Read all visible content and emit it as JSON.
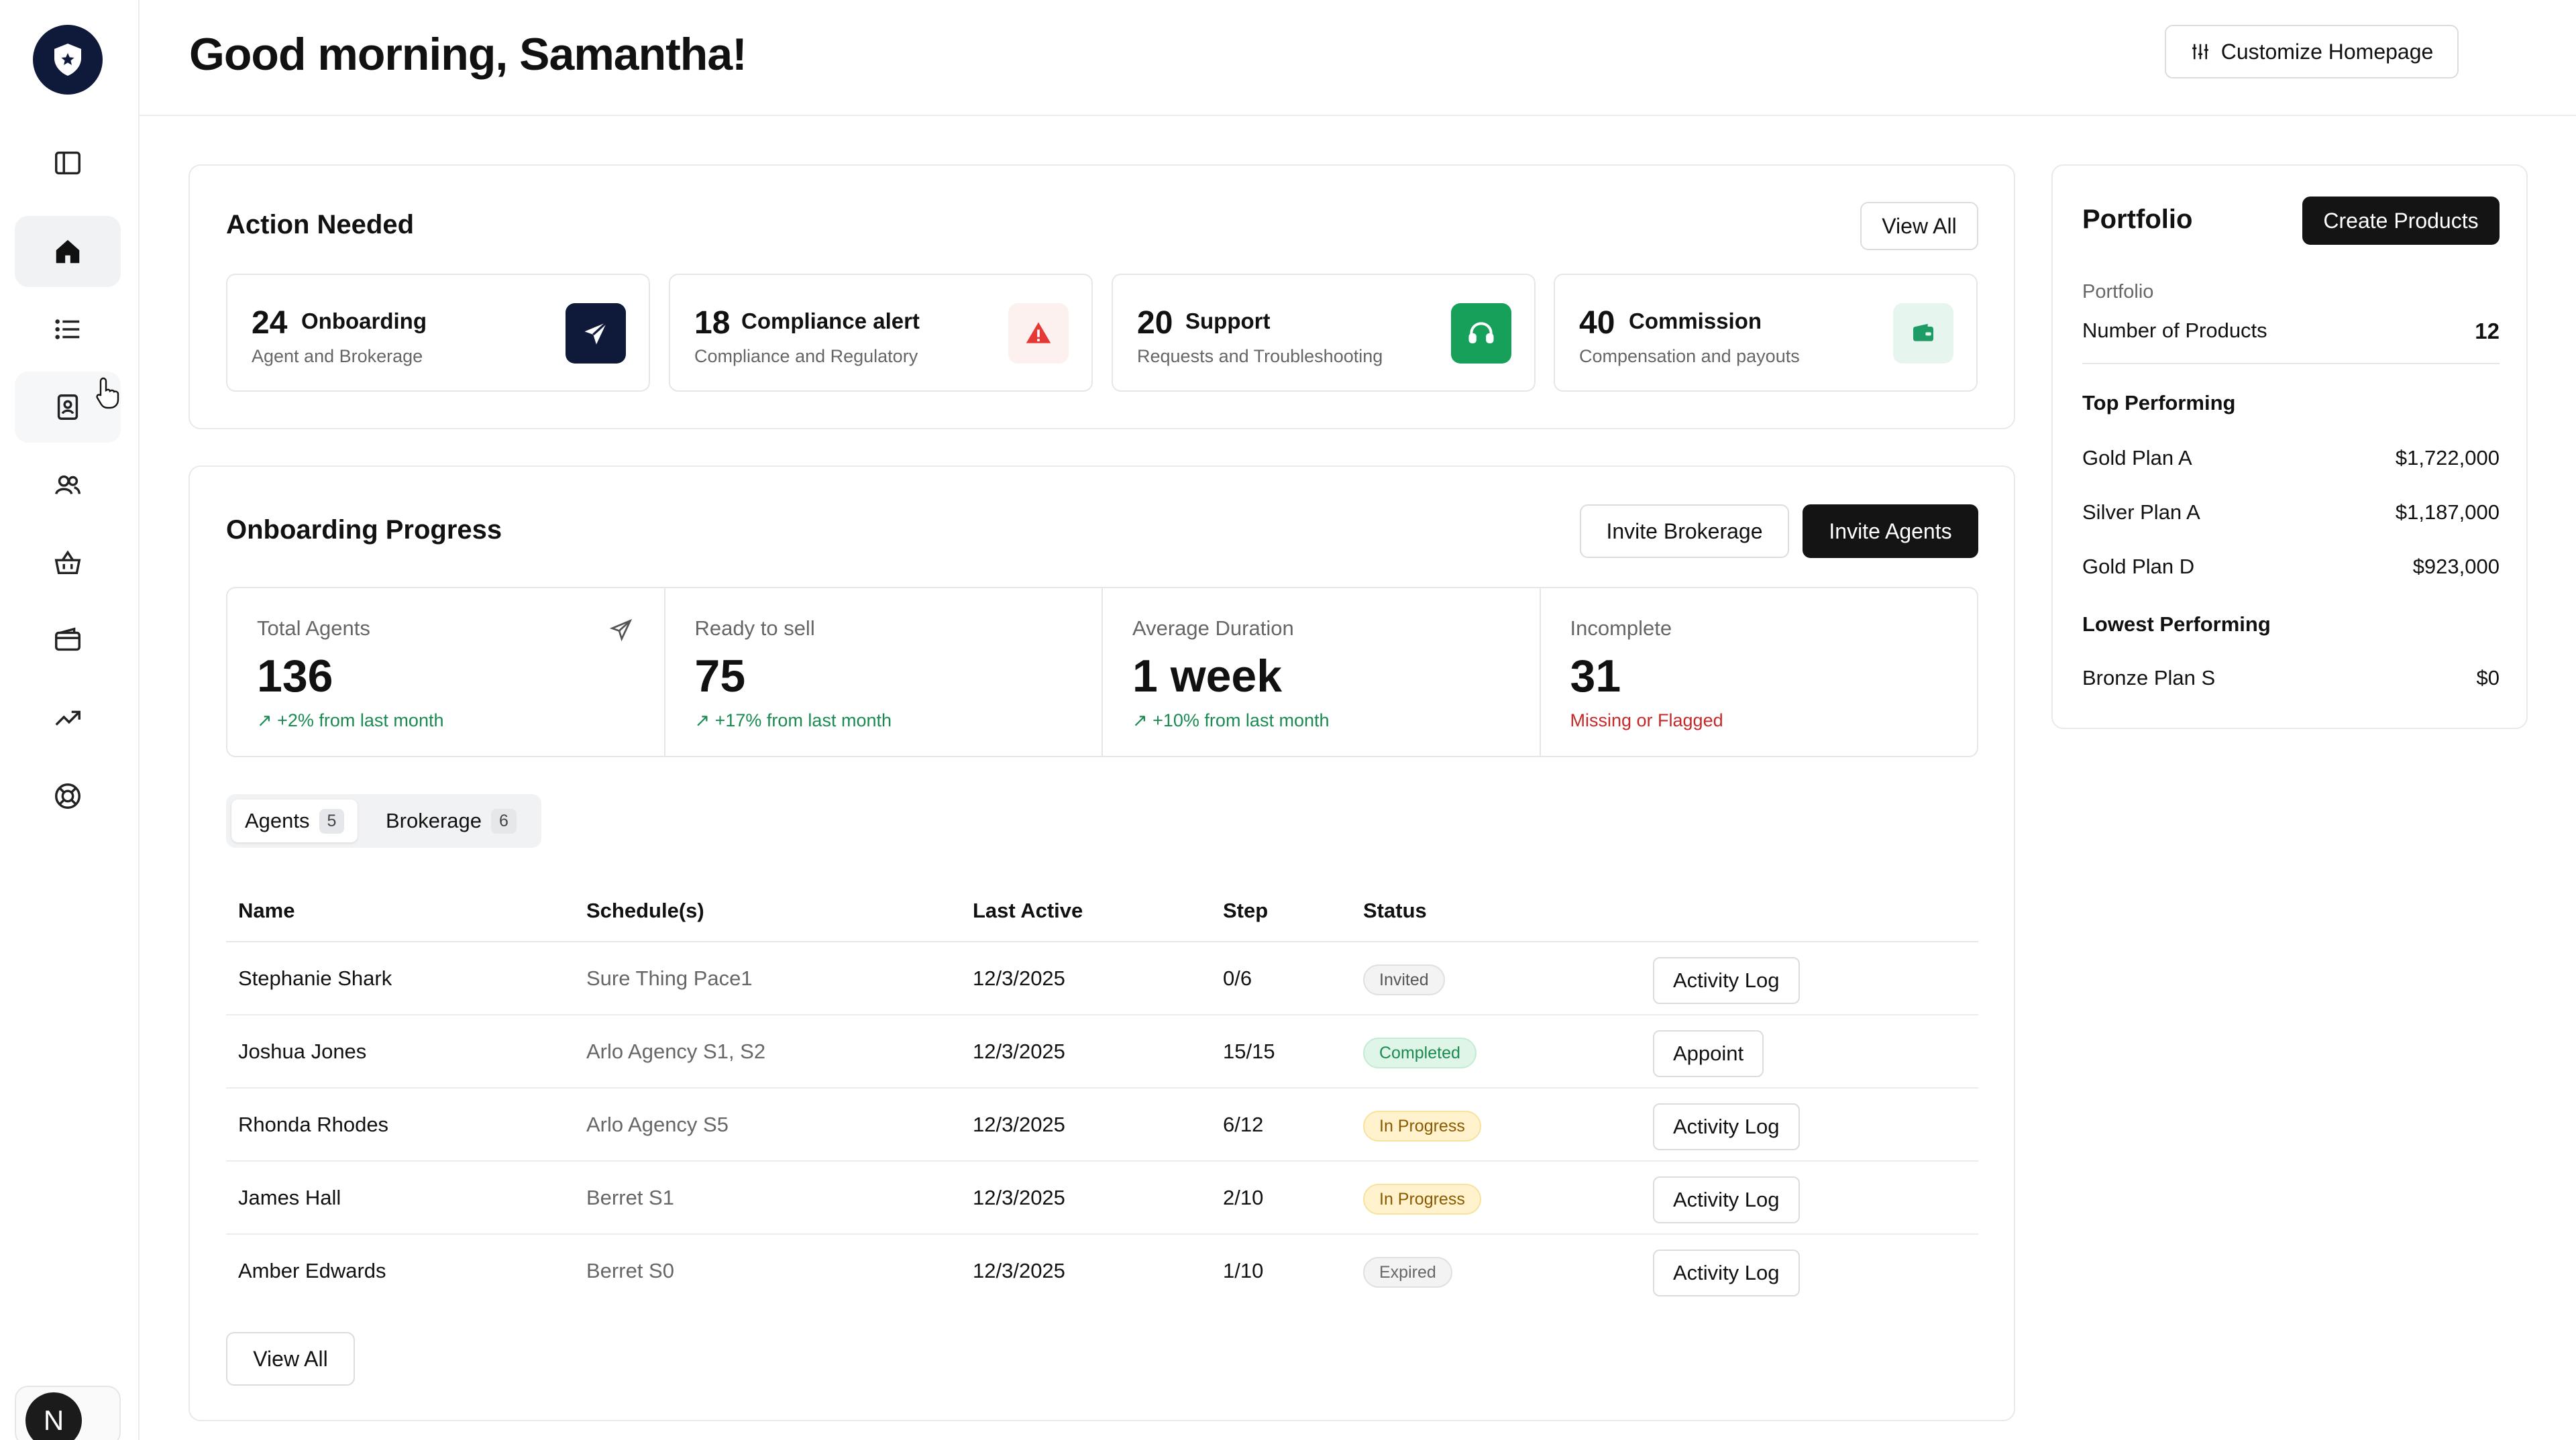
{
  "header": {
    "greeting": "Good morning, Samantha!",
    "customize_label": "Customize Homepage"
  },
  "sidebar": {
    "items": [
      "sidebar-toggle",
      "home",
      "list",
      "contacts",
      "users",
      "products",
      "wallet",
      "trends",
      "support"
    ],
    "avatar_letter": "N"
  },
  "action_needed": {
    "title": "Action Needed",
    "view_all": "View All",
    "tiles": [
      {
        "count": "24",
        "label": "Onboarding",
        "sub": "Agent and Brokerage",
        "icon": "send-icon",
        "color": "#0f1a3a"
      },
      {
        "count": "18",
        "label": "Compliance alert",
        "sub": "Compliance and Regulatory",
        "icon": "alert-icon",
        "color": "#e53935"
      },
      {
        "count": "20",
        "label": "Support",
        "sub": "Requests and Troubleshooting",
        "icon": "headset-icon",
        "color": "#16a05a"
      },
      {
        "count": "40",
        "label": "Commission",
        "sub": "Compensation and payouts",
        "icon": "wallet-icon",
        "color": "#1d9c66"
      }
    ]
  },
  "onboarding": {
    "title": "Onboarding Progress",
    "invite_brokerage": "Invite Brokerage",
    "invite_agents": "Invite Agents",
    "stats": [
      {
        "label": "Total Agents",
        "value": "136",
        "trend": "+2% from last month"
      },
      {
        "label": "Ready to sell",
        "value": "75",
        "trend": "+17% from last month"
      },
      {
        "label": "Average Duration",
        "value": "1 week",
        "trend": "+10% from last month"
      },
      {
        "label": "Incomplete",
        "value": "31",
        "trend": "Missing or Flagged"
      }
    ],
    "tabs": [
      {
        "label": "Agents",
        "count": "5"
      },
      {
        "label": "Brokerage",
        "count": "6"
      }
    ],
    "columns": [
      "Name",
      "Schedule(s)",
      "Last Active",
      "Step",
      "Status"
    ],
    "rows": [
      {
        "name": "Stephanie Shark",
        "schedule": "Sure Thing Pace1",
        "last_active": "12/3/2025",
        "step": "0/6",
        "status": "Invited",
        "action": "Activity Log"
      },
      {
        "name": "Joshua Jones",
        "schedule": "Arlo Agency S1, S2",
        "last_active": "12/3/2025",
        "step": "15/15",
        "status": "Completed",
        "action": "Appoint"
      },
      {
        "name": "Rhonda Rhodes",
        "schedule": "Arlo Agency S5",
        "last_active": "12/3/2025",
        "step": "6/12",
        "status": "In Progress",
        "action": "Activity Log"
      },
      {
        "name": "James Hall",
        "schedule": "Berret S1",
        "last_active": "12/3/2025",
        "step": "2/10",
        "status": "In Progress",
        "action": "Activity Log"
      },
      {
        "name": "Amber Edwards",
        "schedule": "Berret S0",
        "last_active": "12/3/2025",
        "step": "1/10",
        "status": "Expired",
        "action": "Activity Log"
      }
    ],
    "view_all": "View All"
  },
  "portfolio": {
    "title": "Portfolio",
    "create_label": "Create Products",
    "section_label": "Portfolio",
    "num_products_label": "Number of Products",
    "num_products": "12",
    "top_label": "Top Performing",
    "top": [
      {
        "name": "Gold Plan A",
        "value": "$1,722,000"
      },
      {
        "name": "Silver Plan A",
        "value": "$1,187,000"
      },
      {
        "name": "Gold Plan D",
        "value": "$923,000"
      }
    ],
    "lowest_label": "Lowest Performing",
    "lowest": [
      {
        "name": "Bronze Plan S",
        "value": "$0"
      }
    ]
  }
}
